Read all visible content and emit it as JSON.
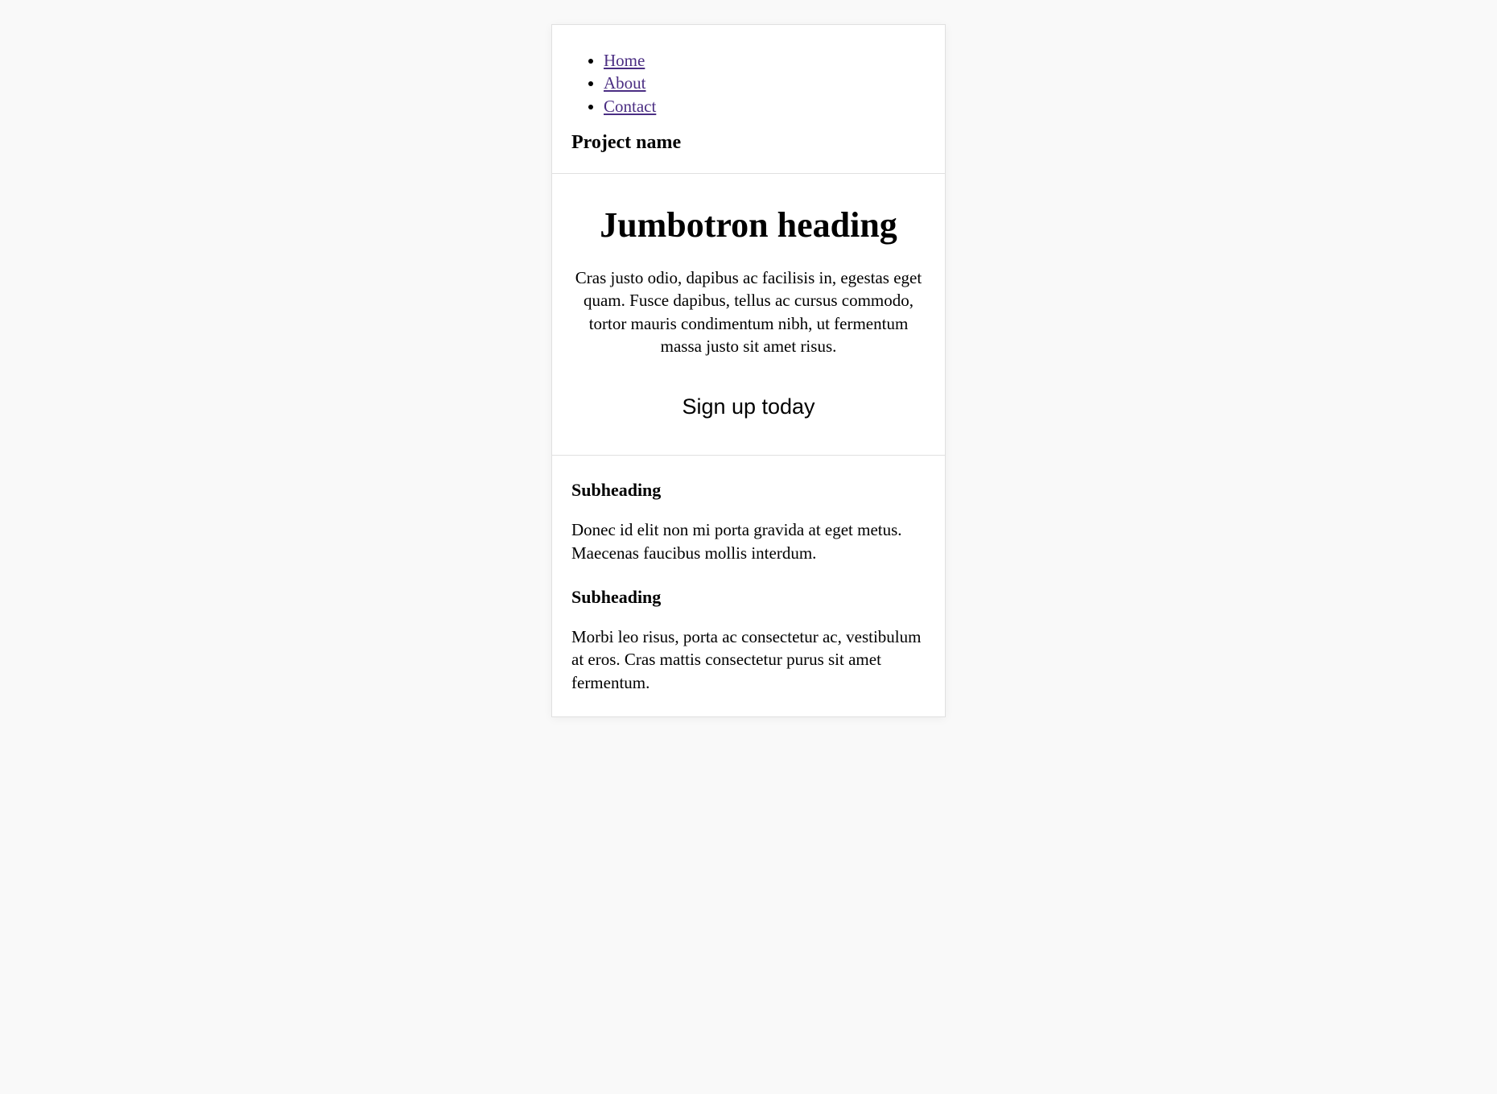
{
  "nav": {
    "items": [
      {
        "label": "Home"
      },
      {
        "label": "About"
      },
      {
        "label": "Contact"
      }
    ]
  },
  "brand": "Project name",
  "jumbotron": {
    "heading": "Jumbotron heading",
    "lead": "Cras justo odio, dapibus ac facilisis in, egestas eget quam. Fusce dapibus, tellus ac cursus commodo, tortor mauris condimentum nibh, ut fermentum massa justo sit amet risus.",
    "cta": "Sign up today"
  },
  "sections": [
    {
      "title": "Subheading",
      "body": "Donec id elit non mi porta gravida at eget metus. Maecenas faucibus mollis interdum."
    },
    {
      "title": "Subheading",
      "body": "Morbi leo risus, porta ac consectetur ac, vestibulum at eros. Cras mattis consectetur purus sit amet fermentum."
    }
  ]
}
